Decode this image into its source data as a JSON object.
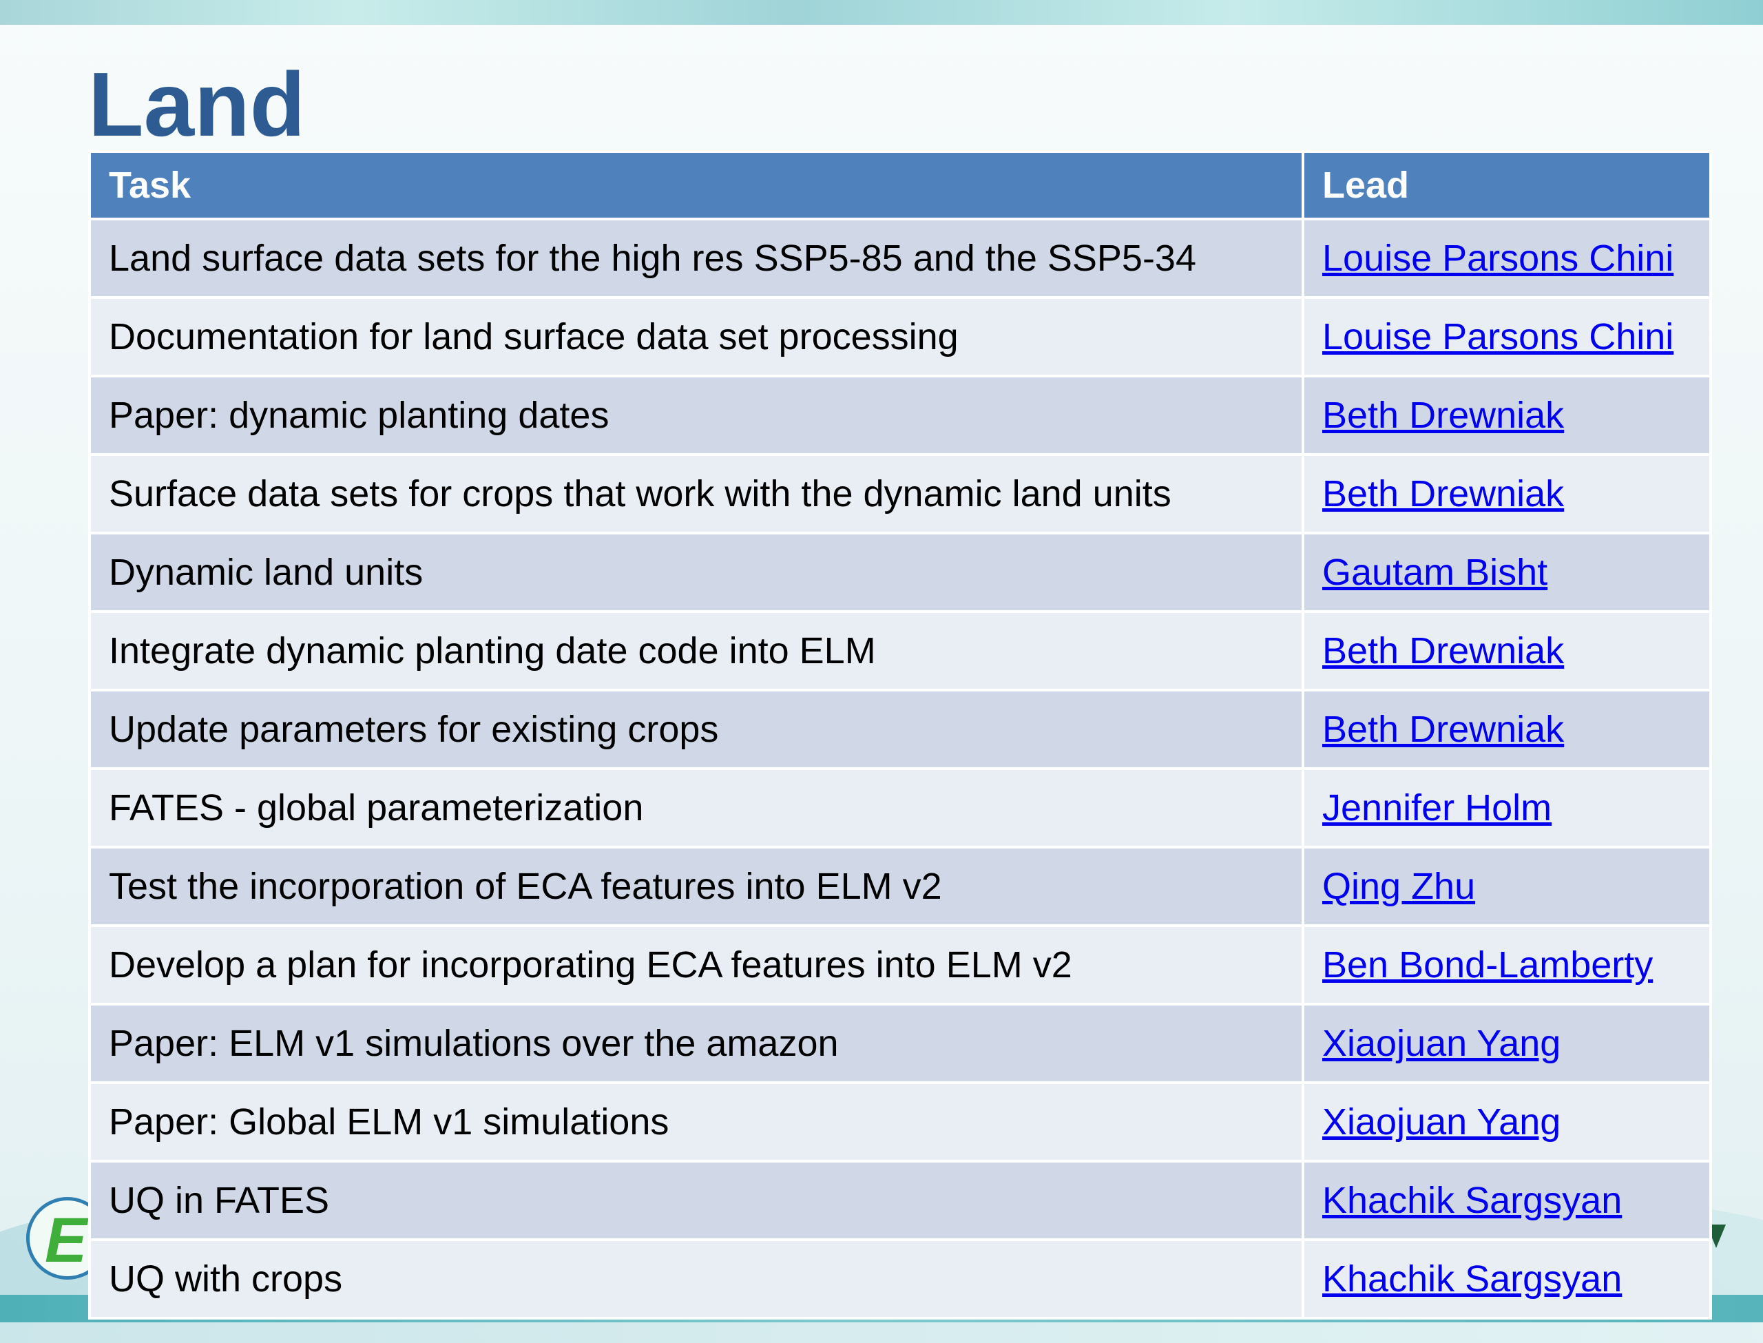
{
  "slide": {
    "title": "Land"
  },
  "table": {
    "headers": {
      "task": "Task",
      "lead": "Lead"
    },
    "rows": [
      {
        "task": "Land surface data sets for the high res SSP5-85 and the SSP5-34",
        "lead": "Louise Parsons Chini"
      },
      {
        "task": "Documentation for land surface data set processing",
        "lead": "Louise Parsons Chini"
      },
      {
        "task": "Paper: dynamic planting dates",
        "lead": "Beth Drewniak"
      },
      {
        "task": "Surface data sets for crops that work with the dynamic land units",
        "lead": "Beth Drewniak"
      },
      {
        "task": "Dynamic land units",
        "lead": "Gautam Bisht"
      },
      {
        "task": "Integrate dynamic planting date code into ELM",
        "lead": "Beth Drewniak"
      },
      {
        "task": "Update parameters for existing crops",
        "lead": "Beth Drewniak"
      },
      {
        "task": "FATES - global parameterization",
        "lead": "Jennifer Holm"
      },
      {
        "task": "Test the incorporation of ECA features into ELM v2",
        "lead": "Qing Zhu"
      },
      {
        "task": "Develop a plan for incorporating ECA features into ELM v2",
        "lead": "Ben Bond-Lamberty"
      },
      {
        "task": "Paper: ELM v1 simulations over the amazon",
        "lead": "Xiaojuan Yang"
      },
      {
        "task": "Paper: Global ELM v1 simulations",
        "lead": "Xiaojuan Yang"
      },
      {
        "task": "UQ in FATES",
        "lead": "Khachik Sargsyan"
      },
      {
        "task": "UQ with crops",
        "lead": "Khachik Sargsyan"
      }
    ]
  },
  "logo": {
    "letter": "E"
  },
  "colors": {
    "title": "#2e5c92",
    "header_bg": "#4f81bd",
    "row_dark": "#d0d8e8",
    "row_light": "#e9edf4",
    "link": "#0000ee"
  }
}
